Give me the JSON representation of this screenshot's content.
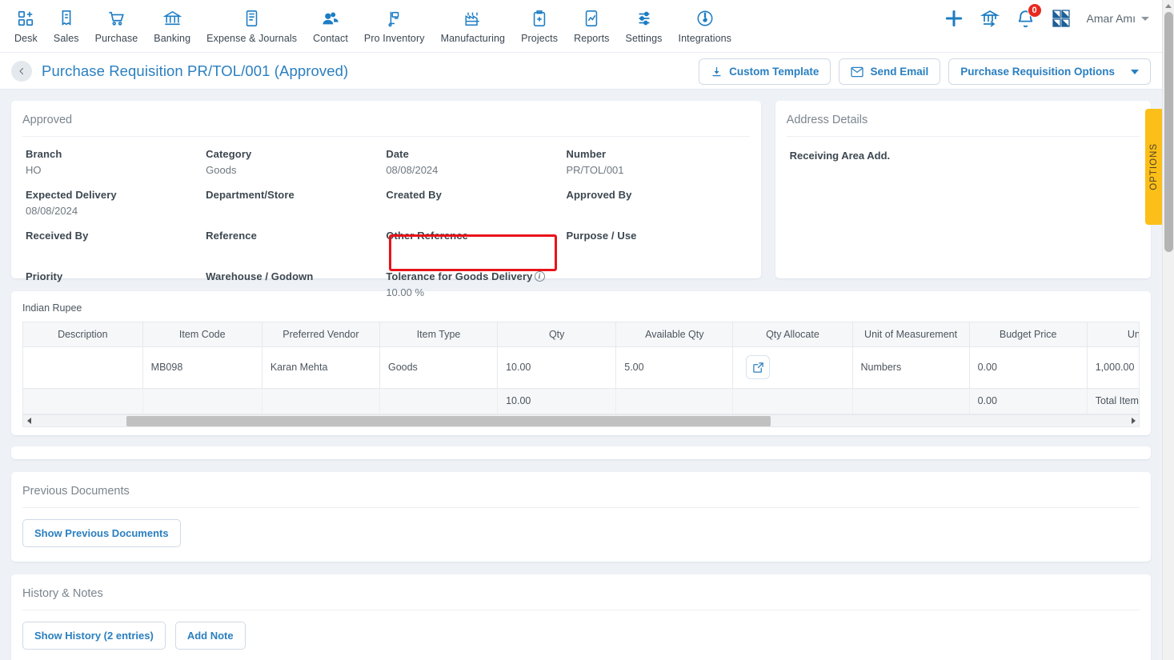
{
  "topnav": {
    "items": [
      {
        "label": "Desk",
        "icon": "desk-grid-plus-icon"
      },
      {
        "label": "Sales",
        "icon": "sales-receipt-icon"
      },
      {
        "label": "Purchase",
        "icon": "purchase-cart-icon"
      },
      {
        "label": "Banking",
        "icon": "banking-bank-icon"
      },
      {
        "label": "Expense & Journals",
        "icon": "expense-journal-icon"
      },
      {
        "label": "Contact",
        "icon": "contact-people-icon"
      },
      {
        "label": "Pro Inventory",
        "icon": "pro-inventory-icon"
      },
      {
        "label": "Manufacturing",
        "icon": "manufacturing-factory-icon"
      },
      {
        "label": "Projects",
        "icon": "projects-clipboard-icon"
      },
      {
        "label": "Reports",
        "icon": "reports-chart-icon"
      },
      {
        "label": "Settings",
        "icon": "settings-sliders-icon"
      },
      {
        "label": "Integrations",
        "icon": "integrations-plug-icon"
      }
    ],
    "notification_count": "0",
    "user_name": "Amar Amı"
  },
  "header": {
    "title": "Purchase Requisition PR/TOL/001 (Approved)",
    "back_icon": "chevron-left-icon",
    "actions": {
      "custom_template": "Custom Template",
      "send_email": "Send Email",
      "options": "Purchase Requisition Options"
    }
  },
  "details": {
    "card_title": "Approved",
    "fields": [
      {
        "label": "Branch",
        "value": "HO"
      },
      {
        "label": "Category",
        "value": "Goods"
      },
      {
        "label": "Date",
        "value": "08/08/2024"
      },
      {
        "label": "Number",
        "value": "PR/TOL/001"
      },
      {
        "label": "Expected Delivery",
        "value": "08/08/2024"
      },
      {
        "label": "Department/Store",
        "value": ""
      },
      {
        "label": "Created By",
        "value": ""
      },
      {
        "label": "Approved By",
        "value": ""
      },
      {
        "label": "Received By",
        "value": ""
      },
      {
        "label": "Reference",
        "value": ""
      },
      {
        "label": "Other Reference",
        "value": ""
      },
      {
        "label": "Purpose / Use",
        "value": ""
      },
      {
        "label": "Priority",
        "value": ""
      },
      {
        "label": "Warehouse / Godown",
        "value": ""
      },
      {
        "label": "Tolerance for Goods Delivery",
        "value": "10.00 %",
        "info": true
      },
      {
        "label": "",
        "value": ""
      }
    ],
    "highlight_color": "#e8131a"
  },
  "address": {
    "card_title": "Address Details",
    "body": "Receiving Area Add.",
    "options_tab": "OPTIONS",
    "options_tab_color": "#fcbf19"
  },
  "items": {
    "currency": "Indian Rupee",
    "columns": [
      "Description",
      "Item Code",
      "Preferred Vendor",
      "Item Type",
      "Qty",
      "Available Qty",
      "Qty Allocate",
      "Unit of Measurement",
      "Budget Price",
      "Unit Price/Rate"
    ],
    "rows": [
      {
        "description": "",
        "item_code": "MB098",
        "preferred_vendor": "Karan Mehta",
        "item_type": "Goods",
        "qty": "10.00",
        "available_qty": "5.00",
        "qty_allocate_icon": "external-link-icon",
        "unit_of_measurement": "Numbers",
        "budget_price": "0.00",
        "unit_price": "1,000.00"
      }
    ],
    "totals": {
      "qty": "10.00",
      "budget_price": "0.00",
      "unit_price": "Total Item Va"
    }
  },
  "previous_documents": {
    "title": "Previous Documents",
    "button": "Show Previous Documents"
  },
  "history_notes": {
    "title": "History & Notes",
    "show_history": "Show History (2 entries)",
    "add_note": "Add Note"
  },
  "theme": {
    "accent": "#2a7fc0",
    "page_bg": "#eef2f7",
    "badge_red": "#e8291e"
  }
}
